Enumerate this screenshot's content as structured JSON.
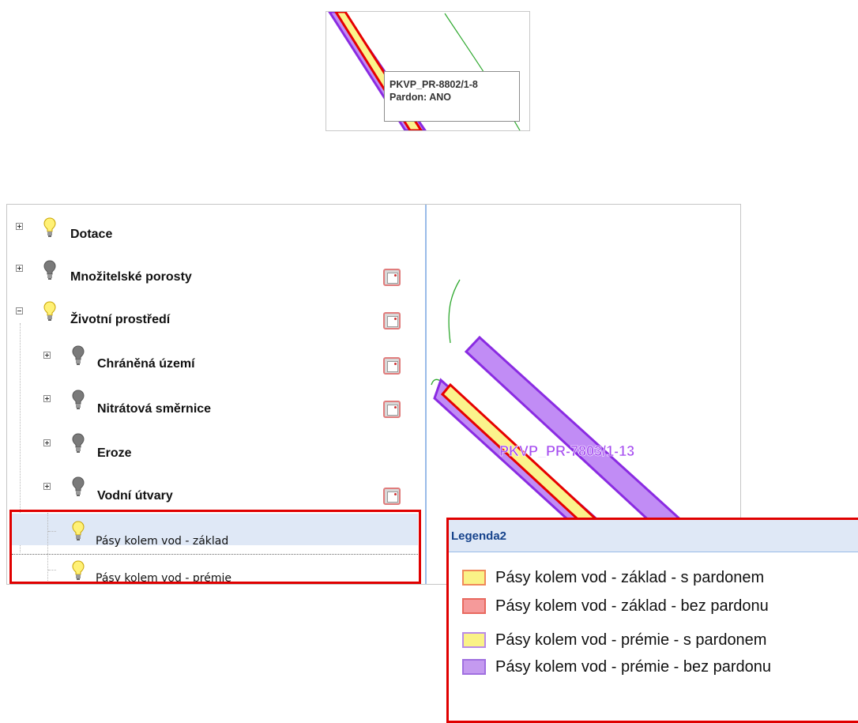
{
  "tooltip": {
    "line1": "PKVP_PR-8802/1-8",
    "line2": "Pardon: ANO"
  },
  "tree": {
    "nodes": [
      {
        "label": "Dotace",
        "expander": "plus",
        "bulb": "on"
      },
      {
        "label": "Množitelské porosty",
        "expander": "plus",
        "bulb": "off"
      },
      {
        "label": "Životní prostředí",
        "expander": "minus",
        "bulb": "on"
      },
      {
        "label": "Chráněná území",
        "expander": "plus",
        "bulb": "off"
      },
      {
        "label": "Nitrátová směrnice",
        "expander": "plus",
        "bulb": "off"
      },
      {
        "label": "Eroze",
        "expander": "plus",
        "bulb": "off"
      },
      {
        "label": "Vodní útvary",
        "expander": "plus",
        "bulb": "off"
      }
    ],
    "leaves": [
      {
        "label": "Pásy kolem vod - základ",
        "bulb": "on",
        "selected": true
      },
      {
        "label": "Pásy kolem vod - prémie",
        "bulb": "on",
        "selected": false
      }
    ]
  },
  "map": {
    "feature_label": "PKVP_PR-7803/1-13",
    "colors": {
      "feature_label": "#a64df0",
      "purple_fill": "#c18cf5",
      "purple_stroke": "#8a2be2",
      "yellow_fill": "#fbf38c",
      "red_stroke": "#e60000",
      "green_line": "#2ea82e"
    }
  },
  "legend": {
    "title": "Legenda2",
    "items": [
      {
        "label": "Pásy kolem vod - základ - s pardonem",
        "fill": "#faf287",
        "stroke": "#f08a5a"
      },
      {
        "label": "Pásy kolem vod - základ - bez pardonu",
        "fill": "#f59a9a",
        "stroke": "#e8695f"
      },
      {
        "label": "Pásy kolem vod - prémie - s pardonem",
        "fill": "#faf287",
        "stroke": "#b98be8"
      },
      {
        "label": "Pásy kolem vod - prémie - bez pardonu",
        "fill": "#c49af0",
        "stroke": "#a070e0"
      }
    ]
  }
}
